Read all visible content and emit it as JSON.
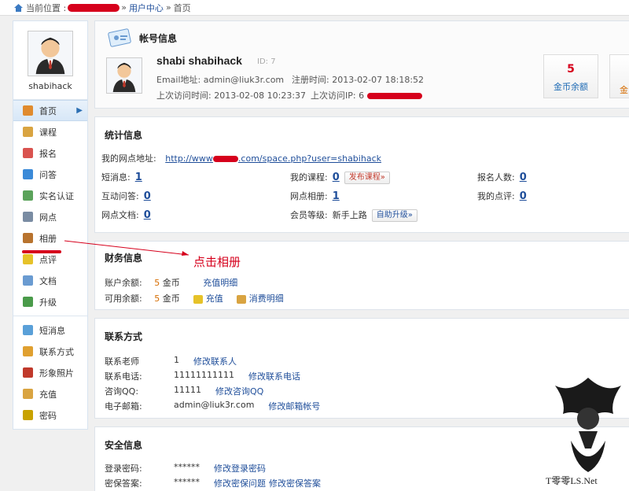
{
  "breadcrumb": {
    "prefix": "当前位置 :",
    "sep1": "»",
    "user_center": "用户中心",
    "sep2": "»",
    "current": "首页"
  },
  "sidebar": {
    "username": "shabihack",
    "items": [
      {
        "label": "首页",
        "icon": "home-icon",
        "color": "#e08b2e",
        "active": true
      },
      {
        "label": "课程",
        "icon": "edit-icon",
        "color": "#d9a441"
      },
      {
        "label": "报名",
        "icon": "signup-icon",
        "color": "#d9534f"
      },
      {
        "label": "问答",
        "icon": "question-icon",
        "color": "#3b8ad8"
      },
      {
        "label": "实名认证",
        "icon": "verify-icon",
        "color": "#5ba35b"
      },
      {
        "label": "网点",
        "icon": "site-icon",
        "color": "#7a8ca3"
      },
      {
        "label": "相册",
        "icon": "album-icon",
        "color": "#b8732e"
      },
      {
        "label": "点评",
        "icon": "comment-icon",
        "color": "#e6c229"
      },
      {
        "label": "文档",
        "icon": "document-icon",
        "color": "#6a9bd1"
      },
      {
        "label": "升级",
        "icon": "upgrade-icon",
        "color": "#4a9b4a"
      },
      {
        "label": "短消息",
        "icon": "message-icon",
        "color": "#5aa0d8"
      },
      {
        "label": "联系方式",
        "icon": "contact-icon",
        "color": "#e0a030"
      },
      {
        "label": "形象照片",
        "icon": "photo-icon",
        "color": "#c0392b"
      },
      {
        "label": "充值",
        "icon": "recharge-icon",
        "color": "#d9a441"
      },
      {
        "label": "密码",
        "icon": "lock-icon",
        "color": "#c8a200"
      }
    ]
  },
  "account": {
    "title": "帐号信息",
    "username": "shabi shabihack",
    "id_label": "ID: 7",
    "email": "Email地址: admin@liuk3r.com",
    "register_time": "注册时间: 2013-02-07 18:18:52",
    "last_visit_time": "上次访问时间: 2013-02-08 10:23:37",
    "last_visit_ip": "上次访问IP: 6",
    "coin_value": "5",
    "coin_label": "金币余额",
    "coin2_label": "金"
  },
  "stats": {
    "title": "统计信息",
    "site_url_label": "我的网点地址:",
    "site_url_prefix": "http://www",
    "site_url_suffix": ".com/space.php?user=shabihack",
    "short_msg_label": "短消息:",
    "short_msg_value": "1",
    "my_courses_label": "我的课程:",
    "my_courses_value": "0",
    "publish_course_btn": "发布课程»",
    "signups_label": "报名人数:",
    "signups_value": "0",
    "qa_label": "互动问答:",
    "qa_value": "0",
    "album_label": "网点相册:",
    "album_value": "1",
    "reviews_label": "我的点评:",
    "reviews_value": "0",
    "docs_label": "网点文档:",
    "docs_value": "0",
    "level_label": "会员等级:",
    "level_value": "新手上路",
    "auto_upgrade_btn": "自助升级»"
  },
  "finance": {
    "title": "财务信息",
    "balance_label": "账户余额:",
    "balance_amount": "5",
    "balance_unit": "金币",
    "recharge_detail": "充值明细",
    "available_label": "可用余额:",
    "available_amount": "5",
    "available_unit": "金币",
    "recharge": "充值",
    "consume_detail": "消费明细"
  },
  "annotation": "点击相册",
  "contact": {
    "title": "联系方式",
    "rows": [
      {
        "label": "联系老师",
        "value": "1",
        "action": "修改联系人"
      },
      {
        "label": "联系电话:",
        "value": "11111111111",
        "action": "修改联系电话"
      },
      {
        "label": "咨询QQ:",
        "value": "11111",
        "action": "修改咨询QQ"
      },
      {
        "label": "电子邮箱:",
        "value": "admin@liuk3r.com",
        "action": "修改邮箱帐号"
      }
    ]
  },
  "security": {
    "title": "安全信息",
    "rows": [
      {
        "label": "登录密码:",
        "value": "******",
        "action": "修改登录密码",
        "action2": ""
      },
      {
        "label": "密保答案:",
        "value": "******",
        "action": "修改密保问题",
        "action2": "修改密保答案"
      }
    ]
  },
  "watermark": "T零零LS.Net"
}
